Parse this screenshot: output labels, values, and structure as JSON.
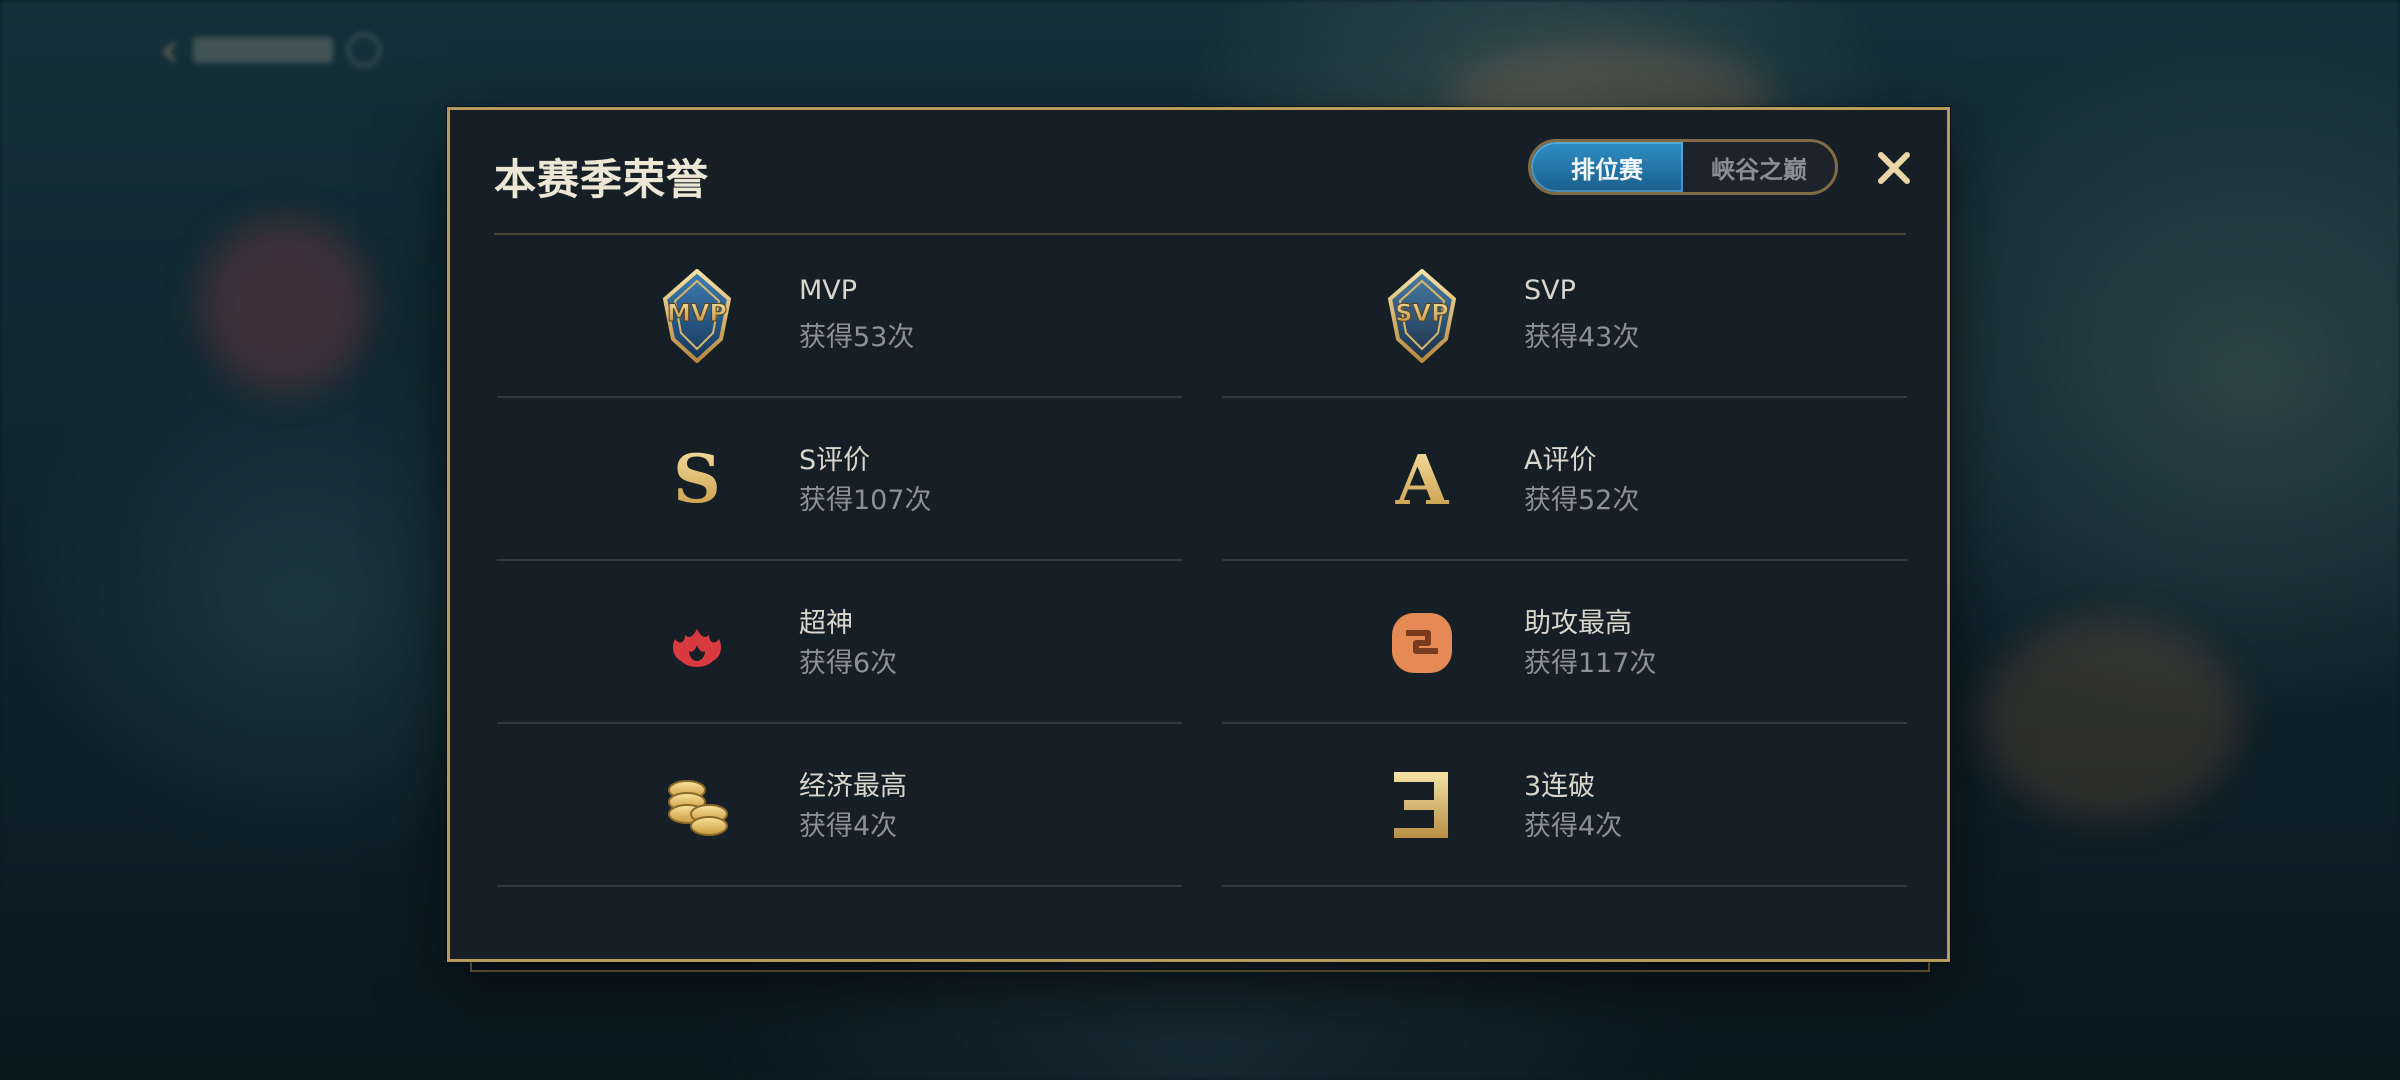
{
  "modal": {
    "title": "本赛季荣誉",
    "tabs": [
      {
        "label": "排位赛",
        "active": true
      },
      {
        "label": "峡谷之巅",
        "active": false
      }
    ],
    "close_icon": "close-icon"
  },
  "honors": [
    {
      "name": "MVP",
      "count": "获得53次",
      "icon": "mvp-badge-icon"
    },
    {
      "name": "SVP",
      "count": "获得43次",
      "icon": "svp-badge-icon"
    },
    {
      "name": "S评价",
      "count": "获得107次",
      "icon": "s-grade-icon"
    },
    {
      "name": "A评价",
      "count": "获得52次",
      "icon": "a-grade-icon"
    },
    {
      "name": "超神",
      "count": "获得6次",
      "icon": "legendary-flame-icon"
    },
    {
      "name": "助攻最高",
      "count": "获得117次",
      "icon": "assist-icon"
    },
    {
      "name": "经济最高",
      "count": "获得4次",
      "icon": "gold-coins-icon"
    },
    {
      "name": "3连破",
      "count": "获得4次",
      "icon": "triple-break-icon"
    }
  ],
  "colors": {
    "frame_gold": "#b79b5c",
    "panel_bg": "#161e26",
    "tab_active": "#2f8fc4",
    "icon_gold": "#e6c878",
    "flame_red": "#d93a3f",
    "assist_orange": "#e58a55"
  }
}
